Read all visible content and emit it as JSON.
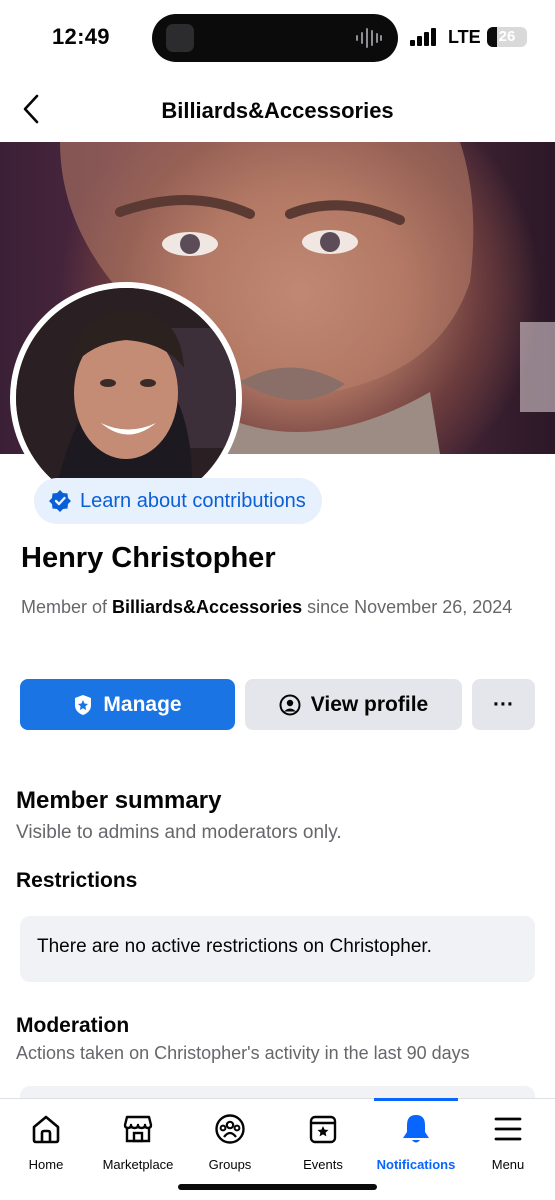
{
  "status_bar": {
    "time": "12:49",
    "network": "LTE",
    "battery": "26"
  },
  "header": {
    "title": "Billiards&Accessories"
  },
  "contributions": {
    "label": "Learn about contributions"
  },
  "member": {
    "name": "Henry Christopher",
    "since_prefix": "Member of ",
    "group_name": "Billiards&Accessories",
    "since_suffix": " since November 26, 2024"
  },
  "actions": {
    "manage": "Manage",
    "view_profile": "View profile",
    "more": "···"
  },
  "summary": {
    "title": "Member summary",
    "subtitle": "Visible to admins and moderators only."
  },
  "restrictions": {
    "title": "Restrictions",
    "text": "There are no active restrictions on Christopher."
  },
  "moderation": {
    "title": "Moderation",
    "subtitle": "Actions taken on Christopher's activity in the last 90 days"
  },
  "tabs": [
    {
      "label": "Home",
      "icon": "home-icon"
    },
    {
      "label": "Marketplace",
      "icon": "marketplace-icon"
    },
    {
      "label": "Groups",
      "icon": "groups-icon"
    },
    {
      "label": "Events",
      "icon": "events-icon"
    },
    {
      "label": "Notifications",
      "icon": "bell-icon",
      "active": true
    },
    {
      "label": "Menu",
      "icon": "menu-icon"
    }
  ],
  "colors": {
    "primary": "#1b74e4",
    "active_tab": "#0866ff",
    "secondary_button": "#e4e6eb",
    "muted_text": "#65676b"
  }
}
